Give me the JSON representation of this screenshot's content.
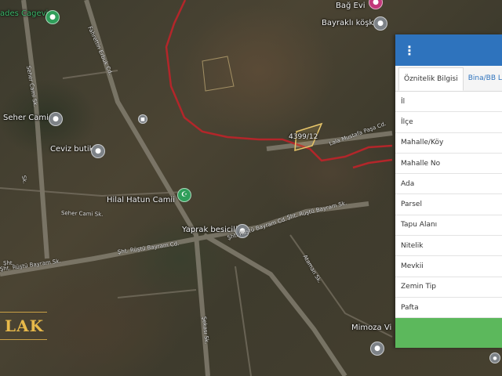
{
  "map": {
    "labels": [
      {
        "id": "ades",
        "text": "ades Cagevi"
      },
      {
        "id": "bag-evi",
        "text": "Bağ Evi"
      },
      {
        "id": "bayrakli-kosk",
        "text": "Bayraklı köşk"
      },
      {
        "id": "seher-cami",
        "text": "Seher Cami"
      },
      {
        "id": "ceviz-butik",
        "text": "Ceviz butik"
      },
      {
        "id": "hilal-hatun",
        "text": "Hilal Hatun Camii"
      },
      {
        "id": "yaprak",
        "text": "Yaprak besicilik"
      },
      {
        "id": "mimoza",
        "text": "Mimoza Vi"
      }
    ],
    "streets": [
      {
        "id": "seher-cami-sk-1",
        "text": "Seher Cami Sk."
      },
      {
        "id": "seher-cami-sk-2",
        "text": "Seher Cami Sk."
      },
      {
        "id": "fahrettin-cd",
        "text": "Fahrettin Erbuk Cd."
      },
      {
        "id": "rustu-1",
        "text": "Şht. Rüştü Bayram Sk."
      },
      {
        "id": "rustu-2",
        "text": "Şht. Rüştü Bayram Sk."
      },
      {
        "id": "rustu-3",
        "text": "Şht. Rüştü Bayram Cd."
      },
      {
        "id": "rustu-4",
        "text": "Şht. Rüştü Bayram Cd."
      },
      {
        "id": "ataman",
        "text": "Ataman Sk."
      },
      {
        "id": "sekas",
        "text": "Şekası Sk."
      },
      {
        "id": "lala",
        "text": "Lala Mustafa Paşa Cd."
      },
      {
        "id": "sk-left",
        "text": "Sk."
      },
      {
        "id": "sk-left2",
        "text": "Şht."
      }
    ],
    "parcel_label": "4399/12"
  },
  "logo": {
    "text": "LAK"
  },
  "panel": {
    "tabs": [
      "Öznitelik Bilgisi",
      "Bina/BB Lis"
    ],
    "rows": [
      "İl",
      "İlçe",
      "Mahalle/Köy",
      "Mahalle No",
      "Ada",
      "Parsel",
      "Tapu Alanı",
      "Nitelik",
      "Mevkii",
      "Zemin Tip",
      "Pafta"
    ]
  },
  "colors": {
    "panel_header": "#2e73bd",
    "panel_footer": "#5cb85c",
    "boundary": "#b3262a",
    "parcel_outline": "#e8c66a"
  },
  "icons": {
    "menu": "vertical-ellipsis-icon"
  }
}
